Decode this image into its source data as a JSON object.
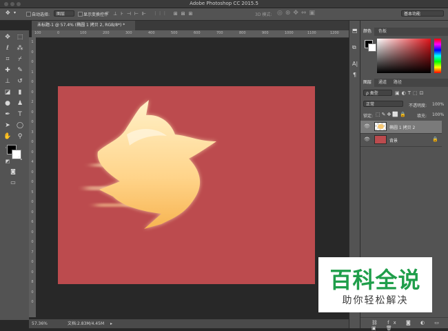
{
  "app": {
    "title": "Adobe Photoshop CC 2015.5"
  },
  "options": {
    "move_icon": "move-tool-icon",
    "auto_select_label": "自动选择:",
    "auto_select_value": "图层",
    "show_transform_label": "显示变换控件",
    "mode_3d_label": "3D 模式:",
    "workspace": "基本功能"
  },
  "document": {
    "tab_title": "未标题-1 @ 57.4% (椭圆 1 拷贝 2, RGB/8*) *"
  },
  "ruler": {
    "h_ticks": [
      "100",
      "0",
      "100",
      "200",
      "300",
      "400",
      "500",
      "600",
      "700",
      "800",
      "900",
      "1000",
      "1100",
      "1200"
    ],
    "v_ticks": [
      "1",
      "0",
      "0",
      "1",
      "0",
      "0",
      "2",
      "0",
      "0",
      "3",
      "0",
      "0",
      "4",
      "0",
      "0",
      "5",
      "0",
      "0",
      "6",
      "0",
      "0",
      "7",
      "0",
      "0",
      "8",
      "0",
      "0"
    ]
  },
  "status": {
    "zoom": "57.36%",
    "doc_size": "文档:2.83M/4.45M"
  },
  "panels": {
    "color_tabs": [
      "颜色",
      "色板"
    ],
    "layers_tabs": [
      "图层",
      "通道",
      "路径"
    ],
    "filter_kind": "ρ 类型",
    "blend_mode": "正常",
    "opacity_label": "不透明度:",
    "opacity_value": "100%",
    "lock_label": "锁定:",
    "fill_label": "填充:",
    "fill_value": "100%",
    "layers": [
      {
        "name": "椭圆 1 拷贝 2",
        "selected": true
      },
      {
        "name": "背景",
        "selected": false
      }
    ]
  },
  "watermark": {
    "title": "百科全说",
    "subtitle": "助你轻松解决"
  },
  "colors": {
    "canvas": "#bc4b4e",
    "foreground": "#000000",
    "background": "#ffffff",
    "watermark_green": "#1f9e4a"
  }
}
